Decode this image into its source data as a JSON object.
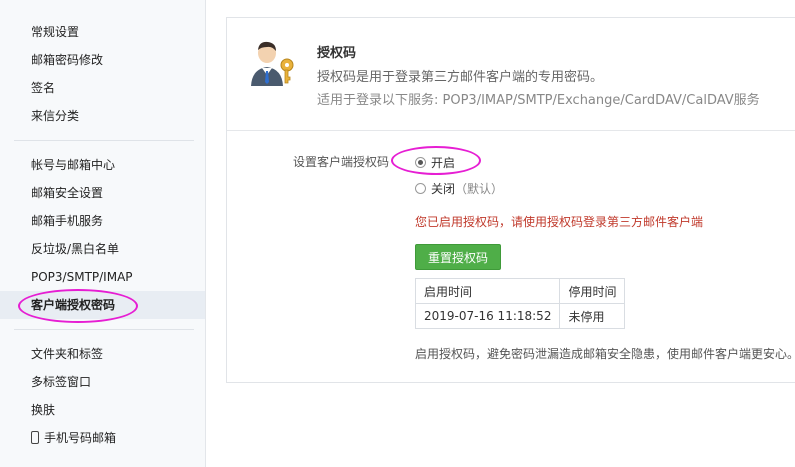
{
  "sidebar": {
    "items": [
      {
        "label": "常规设置"
      },
      {
        "label": "邮箱密码修改"
      },
      {
        "label": "签名"
      },
      {
        "label": "来信分类"
      },
      {
        "label": "帐号与邮箱中心"
      },
      {
        "label": "邮箱安全设置"
      },
      {
        "label": "邮箱手机服务"
      },
      {
        "label": "反垃圾/黑白名单"
      },
      {
        "label": "POP3/SMTP/IMAP"
      },
      {
        "label": "客户端授权密码"
      },
      {
        "label": "文件夹和标签"
      },
      {
        "label": "多标签窗口"
      },
      {
        "label": "换肤"
      },
      {
        "label": "手机号码邮箱"
      }
    ],
    "active_index": 9
  },
  "header": {
    "title": "授权码",
    "description": "授权码是用于登录第三方邮件客户端的专用密码。",
    "services": "适用于登录以下服务: POP3/IMAP/SMTP/Exchange/CardDAV/CalDAV服务"
  },
  "settings": {
    "label": "设置客户端授权码",
    "option_on": "开启",
    "option_off": "关闭",
    "option_off_note": "（默认）",
    "selected": "on",
    "warning": "您已启用授权码，请使用授权码登录第三方邮件客户端",
    "reset_button": "重置授权码"
  },
  "table": {
    "headers": [
      "启用时间",
      "停用时间"
    ],
    "rows": [
      [
        "2019-07-16 11:18:52",
        "未停用"
      ]
    ]
  },
  "footer_note": "启用授权码，避免密码泄漏造成邮箱安全隐患，使用邮件客户端更安心。",
  "colors": {
    "highlight": "#e61ed3",
    "button": "#4fae48",
    "warning": "#c0392b"
  }
}
